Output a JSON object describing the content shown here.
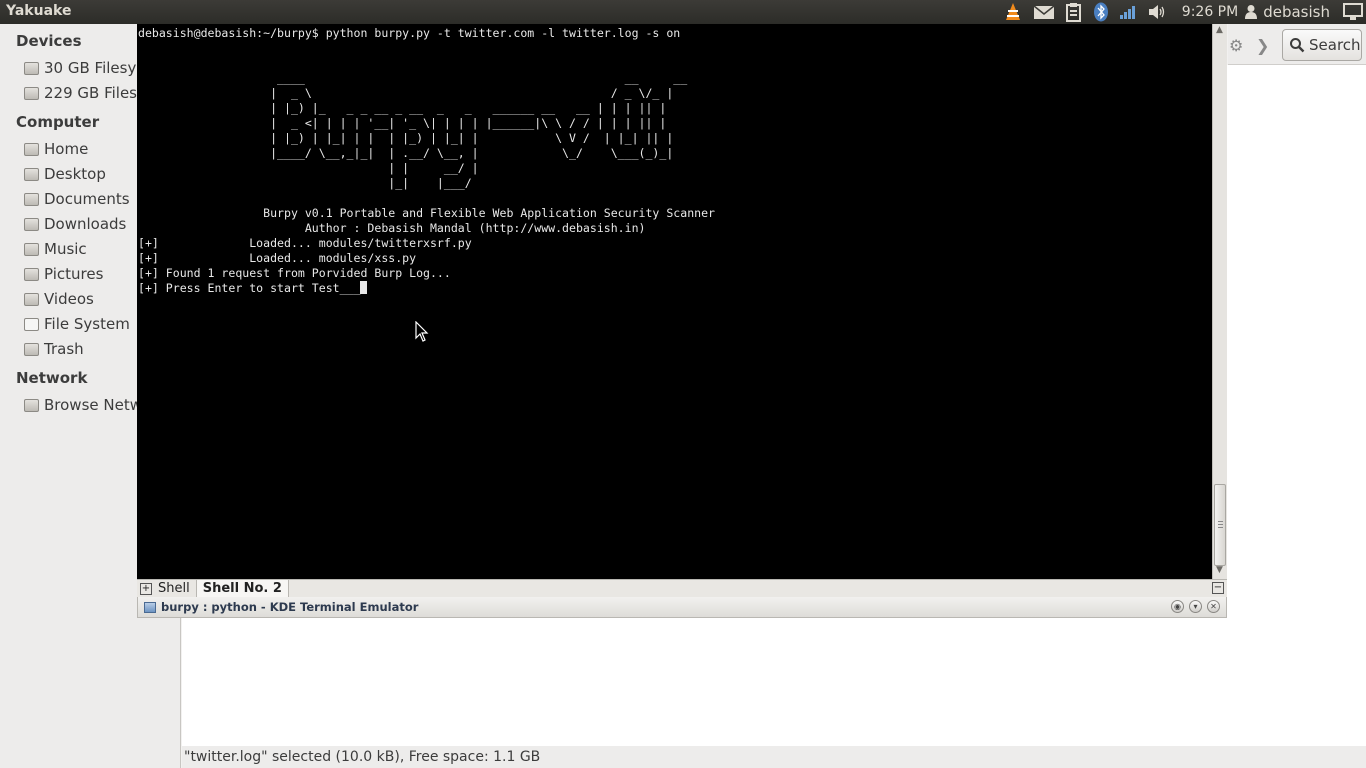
{
  "top_panel": {
    "app_title": "Yakuake",
    "clock": "9:26 PM",
    "user": "debasish",
    "indicators": [
      "vlc-icon",
      "mail-icon",
      "clipboard-icon",
      "bluetooth-icon",
      "network-signal-icon",
      "volume-icon",
      "user-icon",
      "display-icon"
    ]
  },
  "file_manager": {
    "sidebar": {
      "devices_header": "Devices",
      "devices": [
        "30 GB Filesy…",
        "229 GB Files…"
      ],
      "computer_header": "Computer",
      "computer": [
        "Home",
        "Desktop",
        "Documents",
        "Downloads",
        "Music",
        "Pictures",
        "Videos",
        "File System",
        "Trash"
      ],
      "network_header": "Network",
      "network": [
        "Browse Netw"
      ]
    },
    "search_label": "Search",
    "status": "\"twitter.log\" selected (10.0 kB), Free space: 1.1 GB"
  },
  "terminal": {
    "lines": [
      "debasish@debasish:~/burpy$ python burpy.py -t twitter.com -l twitter.log -s on",
      "",
      "",
      "                    ____                                              __     __",
      "                   |  _ \\                                           / _ \\/_ |",
      "                   | |_) |_   _ _ __ _ __  _   _   ______ __   __ | | | || |",
      "                   |  _ <| | | | '__| '_ \\| | | | |______|\\ \\ / / | | | || |",
      "                   | |_) | |_| | |  | |_) | |_| |           \\ V /  | |_| || |",
      "                   |____/ \\__,_|_|  | .__/ \\__, |            \\_/    \\___(_)_|",
      "                                    | |     __/ |",
      "                                    |_|    |___/",
      "",
      "                  Burpy v0.1 Portable and Flexible Web Application Security Scanner",
      "                        Author : Debasish Mandal (http://www.debasish.in)",
      "[+]             Loaded... modules/twitterxsrf.py",
      "[+]             Loaded... modules/xss.py",
      "[+] Found 1 request from Porvided Burp Log...",
      "[+] Press Enter to start Test___"
    ]
  },
  "tabs": {
    "items": [
      "Shell",
      "Shell No. 2"
    ],
    "active_index": 1
  },
  "window": {
    "title": "burpy : python - KDE Terminal Emulator"
  },
  "colors": {
    "terminal_bg": "#000000",
    "terminal_fg": "#e8e8e8",
    "panel_bg": "#3c3b37"
  }
}
